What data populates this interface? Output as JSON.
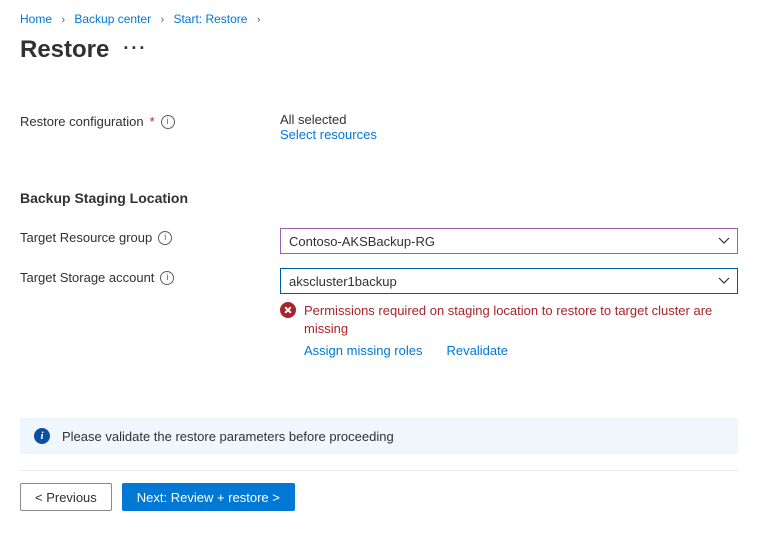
{
  "breadcrumb": {
    "items": [
      "Home",
      "Backup center",
      "Start: Restore"
    ]
  },
  "header": {
    "title": "Restore"
  },
  "form": {
    "restore_config": {
      "label": "Restore configuration",
      "required": true,
      "value": "All selected",
      "link": "Select resources"
    },
    "staging_heading": "Backup Staging Location",
    "target_rg": {
      "label": "Target Resource group",
      "value": "Contoso-AKSBackup-RG"
    },
    "target_sa": {
      "label": "Target Storage account",
      "value": "akscluster1backup",
      "error": "Permissions required on staging location to restore to target cluster are missing",
      "action_assign": "Assign missing roles",
      "action_revalidate": "Revalidate"
    }
  },
  "notice": {
    "text": "Please validate the restore parameters before proceeding"
  },
  "footer": {
    "previous": "< Previous",
    "next": "Next: Review + restore >"
  }
}
